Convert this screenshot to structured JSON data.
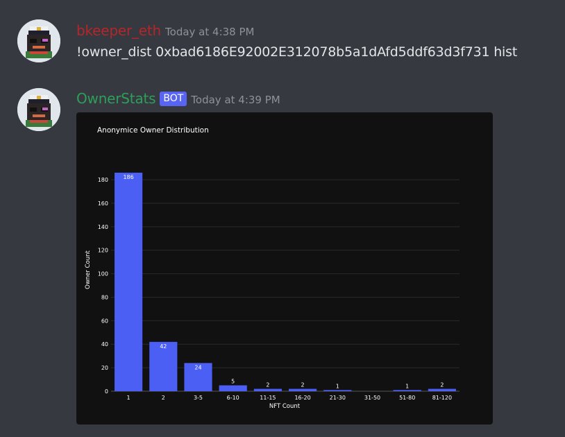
{
  "messages": [
    {
      "username": "bkeeper_eth",
      "username_color": "#b3272a",
      "timestamp": "Today at 4:38 PM",
      "content": "!owner_dist 0xbad6186E92002E312078b5a1dAfd5ddf63d3f731 hist"
    },
    {
      "username": "OwnerStats",
      "username_color": "#2f9e5a",
      "badge": "BOT",
      "timestamp": "Today at 4:39 PM"
    }
  ],
  "chart_data": {
    "type": "bar",
    "title": "Anonymice Owner Distribution",
    "xlabel": "NFT Count",
    "ylabel": "Owner Count",
    "categories": [
      "1",
      "2",
      "3-5",
      "6-10",
      "11-15",
      "16-20",
      "21-30",
      "31-50",
      "51-80",
      "81-120"
    ],
    "values": [
      186,
      42,
      24,
      5,
      2,
      2,
      1,
      0,
      1,
      2
    ],
    "data_labels": [
      "186",
      "42",
      "24",
      "5",
      "2",
      "2",
      "1",
      "",
      "1",
      "2"
    ],
    "yticks": [
      0,
      20,
      40,
      60,
      80,
      100,
      120,
      140,
      160,
      180
    ],
    "ylim": [
      0,
      196
    ],
    "bar_color": "#4c5ff5",
    "grid": true
  }
}
